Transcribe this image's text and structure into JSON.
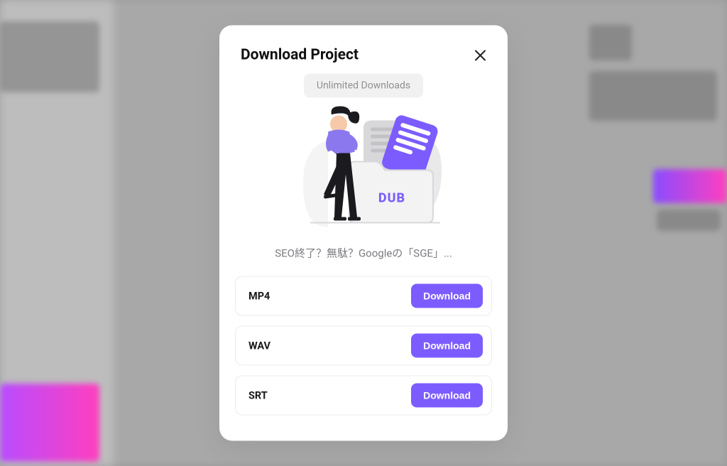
{
  "modal": {
    "title": "Download Project",
    "badge": "Unlimited Downloads",
    "project_name": "SEO終了？無駄？Googleの「SGE」...",
    "dub_label": "DUB",
    "formats": [
      {
        "name": "MP4",
        "button": "Download"
      },
      {
        "name": "WAV",
        "button": "Download"
      },
      {
        "name": "SRT",
        "button": "Download"
      }
    ]
  },
  "colors": {
    "accent": "#7c5cff"
  }
}
